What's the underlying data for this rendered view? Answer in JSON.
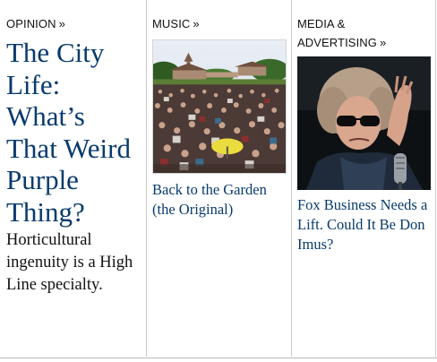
{
  "columns": [
    {
      "section": "OPINION",
      "chevron": "»",
      "headline": "The City Life: What’s That Weird Purple Thing?",
      "summary": "Horticultural ingenuity is a High Line specialty."
    },
    {
      "section": "MUSIC",
      "chevron": "»",
      "headline": "Back to the Garden (the Original)",
      "image": "festival-crowd-photo"
    },
    {
      "section": "MEDIA & ADVERTISING",
      "chevron": "»",
      "headline": "Fox Business Needs a Lift. Could It Be Don Imus?",
      "image": "radio-host-photo"
    }
  ],
  "colors": {
    "headline": "#083a6e",
    "text": "#111111",
    "divider": "#cccccc"
  }
}
